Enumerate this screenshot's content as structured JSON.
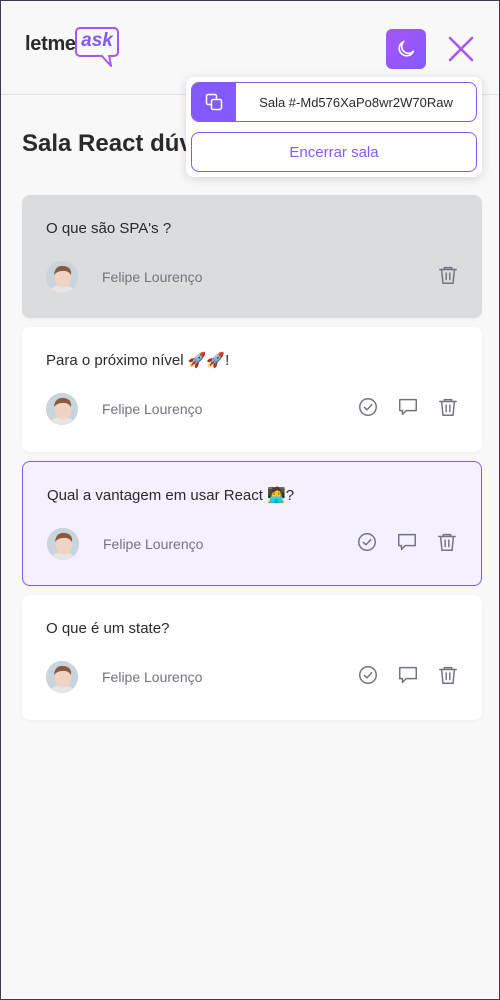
{
  "app": {
    "logo_text": "letme",
    "logo_accent": "ask"
  },
  "header": {
    "room_code_label": "Sala #-Md576XaPo8wr2W70Raw",
    "end_room_label": "Encerrar sala"
  },
  "page": {
    "title": "Sala React dúvidas"
  },
  "colors": {
    "accent": "#835afd",
    "accent_light": "#a855f7",
    "answered_bg": "#dbdcdd",
    "highlighted_bg": "#f4f0ff"
  },
  "questions": [
    {
      "content": "O que são SPA's ?",
      "author": "Felipe Lourenço",
      "state": "answered"
    },
    {
      "content": "Para o próximo nível 🚀🚀!",
      "author": "Felipe Lourenço",
      "state": "normal"
    },
    {
      "content": "Qual a vantagem em usar React 🧑‍💻?",
      "author": "Felipe Lourenço",
      "state": "highlighted"
    },
    {
      "content": "O que é um state?",
      "author": "Felipe Lourenço",
      "state": "normal"
    }
  ]
}
